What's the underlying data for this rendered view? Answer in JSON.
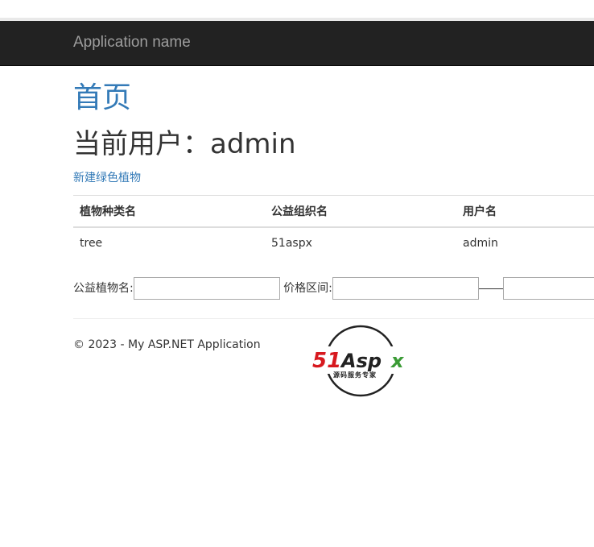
{
  "navbar": {
    "brand": "Application name"
  },
  "page": {
    "title": "首页",
    "current_user_heading": "当前用户：admin",
    "create_link": "新建绿色植物"
  },
  "table": {
    "headers": [
      "植物种类名",
      "公益组织名",
      "用户名"
    ],
    "rows": [
      [
        "tree",
        "51aspx",
        "admin"
      ]
    ]
  },
  "search": {
    "name_label": "公益植物名:",
    "name_value": "",
    "price_label": "价格区间:",
    "price_min_value": "",
    "price_max_value": ""
  },
  "footer": {
    "copyright": "© 2023 - My ASP.NET Application"
  },
  "logo": {
    "text_main": "51Aspx",
    "text_sub": "源码服务专家",
    "colors": {
      "red": "#d7191f",
      "dark": "#222222",
      "green": "#3a9b35"
    }
  },
  "colors": {
    "navbar_bg": "#222222",
    "brand": "#9d9d9d",
    "link": "#337ab7"
  }
}
